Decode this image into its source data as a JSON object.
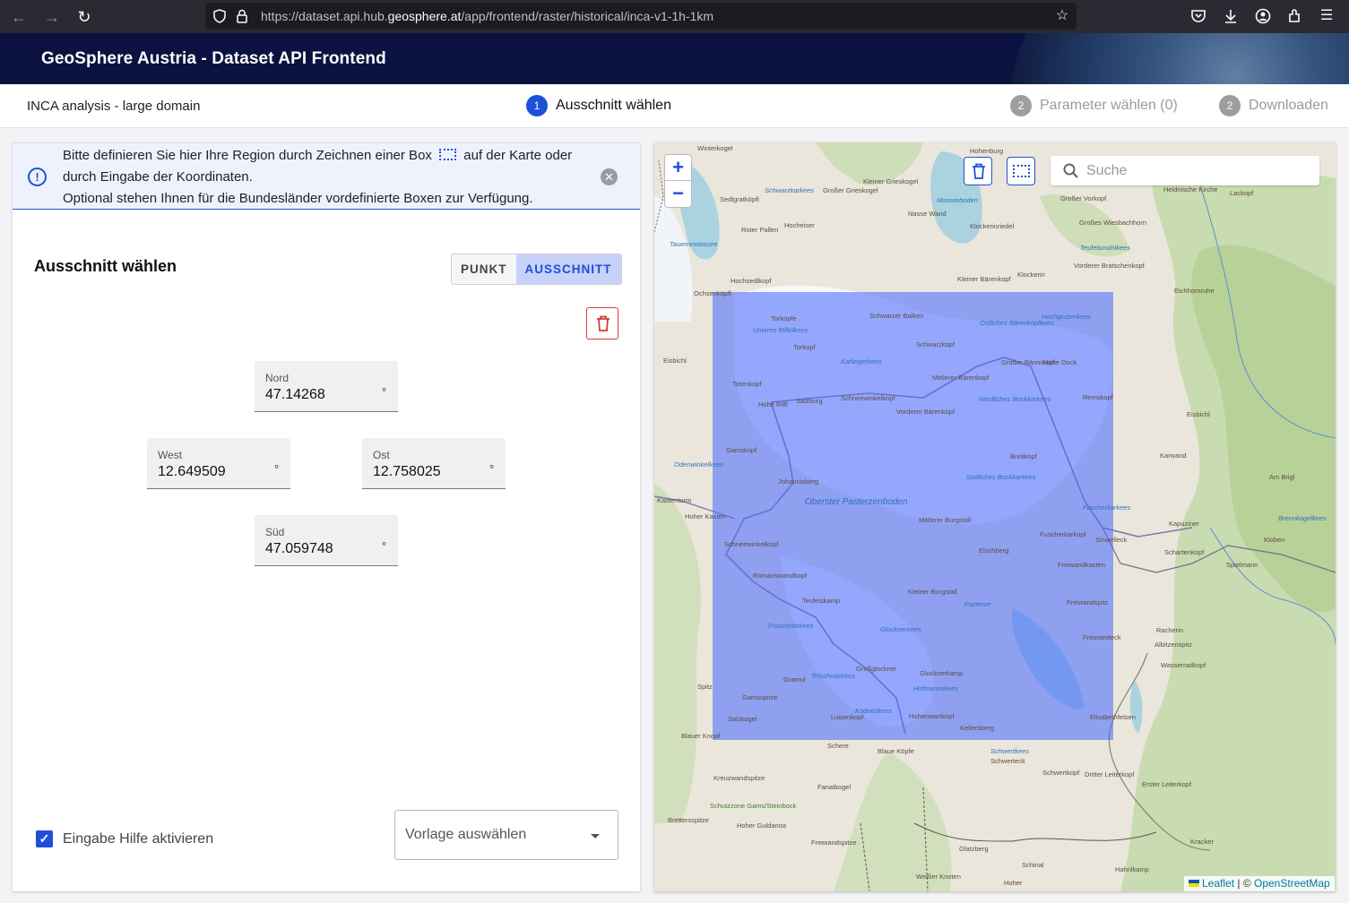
{
  "browser": {
    "url_prefix": "https://dataset.api.hub.",
    "url_host": "geosphere.at",
    "url_path": "/app/frontend/raster/historical/inca-v1-1h-1km"
  },
  "header": {
    "title": "GeoSphere Austria - Dataset API Frontend"
  },
  "stepper": {
    "dataset": "INCA analysis - large domain",
    "steps": [
      {
        "num": "1",
        "label": "Ausschnitt wählen"
      },
      {
        "num": "2",
        "label": "Parameter wählen (0)"
      },
      {
        "num": "2",
        "label": "Downloaden"
      }
    ]
  },
  "info": {
    "line1_a": "Bitte definieren Sie hier Ihre Region durch Zeichnen einer Box",
    "line1_b": "auf der Karte oder",
    "line2": "durch Eingabe der Koordinaten.",
    "line3": "Optional stehen Ihnen für die Bundesländer vordefinierte Boxen zur Verfügung."
  },
  "selection": {
    "title": "Ausschnitt wählen",
    "mode_point": "PUNKT",
    "mode_box": "AUSSCHNITT",
    "north_label": "Nord",
    "north_value": "47.14268",
    "west_label": "West",
    "west_value": "12.649509",
    "east_label": "Ost",
    "east_value": "12.758025",
    "south_label": "Süd",
    "south_value": "47.059748",
    "degree": "°"
  },
  "footer": {
    "help_label": "Eingabe Hilfe aktivieren",
    "help_checked": true,
    "template_placeholder": "Vorlage auswählen"
  },
  "map": {
    "search_placeholder": "Suche",
    "zoom_in": "+",
    "zoom_out": "−",
    "attribution_leaflet": "Leaflet",
    "attribution_sep": " | © ",
    "attribution_osm": "OpenStreetMap",
    "labels": {
      "winterkogel": "Winterkogel",
      "schwarzkarkees": "Schwarzkarkees",
      "grosser_grieskogel": "Großer Grieskogel",
      "kleiner_grieskogel": "Kleiner Grieskogel",
      "sedlgrat": "Sedlgratköpfl",
      "roter_pallen": "Roter Pallen",
      "hocheiser": "Hocheiser",
      "nasse_wand": "Nasse Wand",
      "mooserboden": "Mooserboden",
      "klockerin": "Klockerinriedel",
      "hohenburg": "Hohenburg",
      "grosser_vorkopf": "Großer Vorkopf",
      "grosses_wiesbachhorn": "Großes Wiesbachhorn",
      "heidnische_kirche": "Heidnische Kirche",
      "lackopf": "Lackopf",
      "tauernmoossee": "Tauernmoossee",
      "teufelsmuehlkees": "Teufelsmühlkees",
      "hochsedlkopf": "Hochsedlkopf",
      "kleiner_baerenkopf": "Kleiner Bärenkopf",
      "klockerin2": "Klockerin",
      "vorderer_bratschenkopf": "Vorderer Bratschenkopf",
      "ochsenkoepfl": "Ochsenköpfl",
      "eichhornruhe": "Eichhornruhe",
      "torkopfe": "Torkopfe",
      "schwarzer_balken": "Schwarzer Balken",
      "oestliches_baerenkopfkees": "Östliches Bärenkopfkees",
      "hochgruberkees": "Hochgruberkees",
      "unteres_riffelkees": "Unteres Riffelkees",
      "torkopf": "Torkopf",
      "schwarzkopf": "Schwarzkopf",
      "karlingerkees": "Karlingerkees",
      "eisbichl": "Eisbichl",
      "totenkopf": "Totenkopf",
      "mittlerer_baerenkopf": "Mittlerer Bärenkopf",
      "grosser_baerenkopf": "Großer Bärenkopf",
      "hohe_dock": "Hohe Dock",
      "hohe_riffl": "Hohe Riffl",
      "salzburg": "Salzburg",
      "schneewinkelkoepfl": "Schneewinkelkopf",
      "vorderer_baerenkopf": "Vorderer Bärenkopf",
      "noerdliches_bockkarkees": "Nördliches Bockkarkees",
      "remskopf": "Remskopf",
      "eisbichl2": "Eisbichl",
      "gamskopf": "Gamskopf",
      "odenwinkelkees": "Odenwinkelkees",
      "breitkopf": "Breitkopf",
      "karwand": "Karwand",
      "johannisberg": "Johannisberg",
      "suedliches_bockkarkees": "Südliches Bockkarkees",
      "am_brigl": "Am Brigl",
      "oberster_pasterzenboden": "Oberster Pasterzenboden",
      "kastenturm": "Kastenturm",
      "fuscherkarkees": "Fuscherkarkees",
      "brennkogelkees": "Brennkogelkees",
      "hoher_kasten": "Hoher Kasten",
      "mittlerer_burgstall": "Mittlerer Burgstall",
      "fuscherkarkopf": "Fuscherkarkopf",
      "kapuziner": "Kapuziner",
      "schneewinkelkopf2": "Schneewinkelkopf",
      "elschberg": "Elschberg",
      "sinwelleck": "Sinwelleck",
      "schartenkopf": "Schartenkopf",
      "kloben": "Kloben",
      "romariswandkopf": "Romariswandkopf",
      "freiwandkasten": "Freiwandkasten",
      "spielmann": "Spielmann",
      "teufelskamp": "Teufelskamp",
      "kleiner_burgstall": "Kleiner Burgstall",
      "pasterze": "Pasterze",
      "freiwandspitz": "Freiwandspitz",
      "fruschnitzkees": "Fruschnitzkees",
      "glocknerkees": "Glocknerkees",
      "racherin": "Racherin",
      "albitzenspitz": "Albitzenspitz",
      "freiwandeck": "Freiwandeck",
      "teischnitzkees": "Teischnitzkees",
      "grossglockner": "Großglockner",
      "glocknerkamp": "Glocknerkamp",
      "wasserradkopf": "Wasserradkopf",
      "gramul": "Gramul",
      "hofmannskees": "Hofmannskees",
      "spitz": "Spitz",
      "gamsspitze": "Gamsspitze",
      "koednitzkees": "Ködnitzkees",
      "salzkogel": "Salzkogel",
      "luisenkopf": "Luisenkopf",
      "hohenwartkopf": "Hohenwartkopf",
      "kellersberg": "Kellersberg",
      "elisabethfelsen": "Elisabethfelsen",
      "blauer_knopf": "Blauer Knopf",
      "schere": "Schere",
      "blaue_koepfe": "Blaue Köpfe",
      "schwertkees": "Schwertkees",
      "schwerteck": "Schwerteck",
      "schwertkopf": "Schwertkopf",
      "dritter_leiterkopf": "Dritter Leiterkopf",
      "kreuzwandspitze": "Kreuzwandspitze",
      "fanatkogel": "Fanatkogel",
      "erster_leiterkopf": "Erster Leiterkopf",
      "schutzzone": "Schutzzone Gams/Steinbock",
      "brettersspitze": "Brettersspitze",
      "hoher_guldanoa": "Hoher Guldanoa",
      "kracker": "Kracker",
      "freiwandspitze": "Freiwandspitze",
      "glatzberg": "Glatzberg",
      "schinal": "Schinal",
      "hahnlkamp": "Hahnlkamp",
      "weisser_knoten": "Weißer Knoten",
      "hoher": "Hoher"
    }
  }
}
